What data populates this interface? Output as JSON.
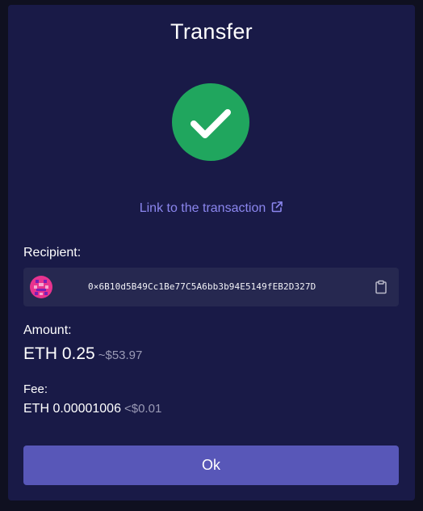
{
  "modal": {
    "title": "Transfer",
    "status_icon": "checkmark-icon",
    "status_color": "#20a65e",
    "link_label": "Link to the transaction",
    "link_icon": "external-link-icon",
    "link_color": "#8b86ee"
  },
  "recipient": {
    "label": "Recipient:",
    "avatar_icon": "identicon-avatar",
    "address": "0×6B10d5B49Cc1Be77C5A6bb3b94E5149fEB2D327D",
    "copy_icon": "clipboard-icon"
  },
  "amount": {
    "label": "Amount:",
    "value": "ETH 0.25",
    "usd": "~$53.97"
  },
  "fee": {
    "label": "Fee:",
    "value": "ETH 0.00001006",
    "usd": "<$0.01"
  },
  "actions": {
    "ok_label": "Ok",
    "ok_color": "#5857b8"
  }
}
